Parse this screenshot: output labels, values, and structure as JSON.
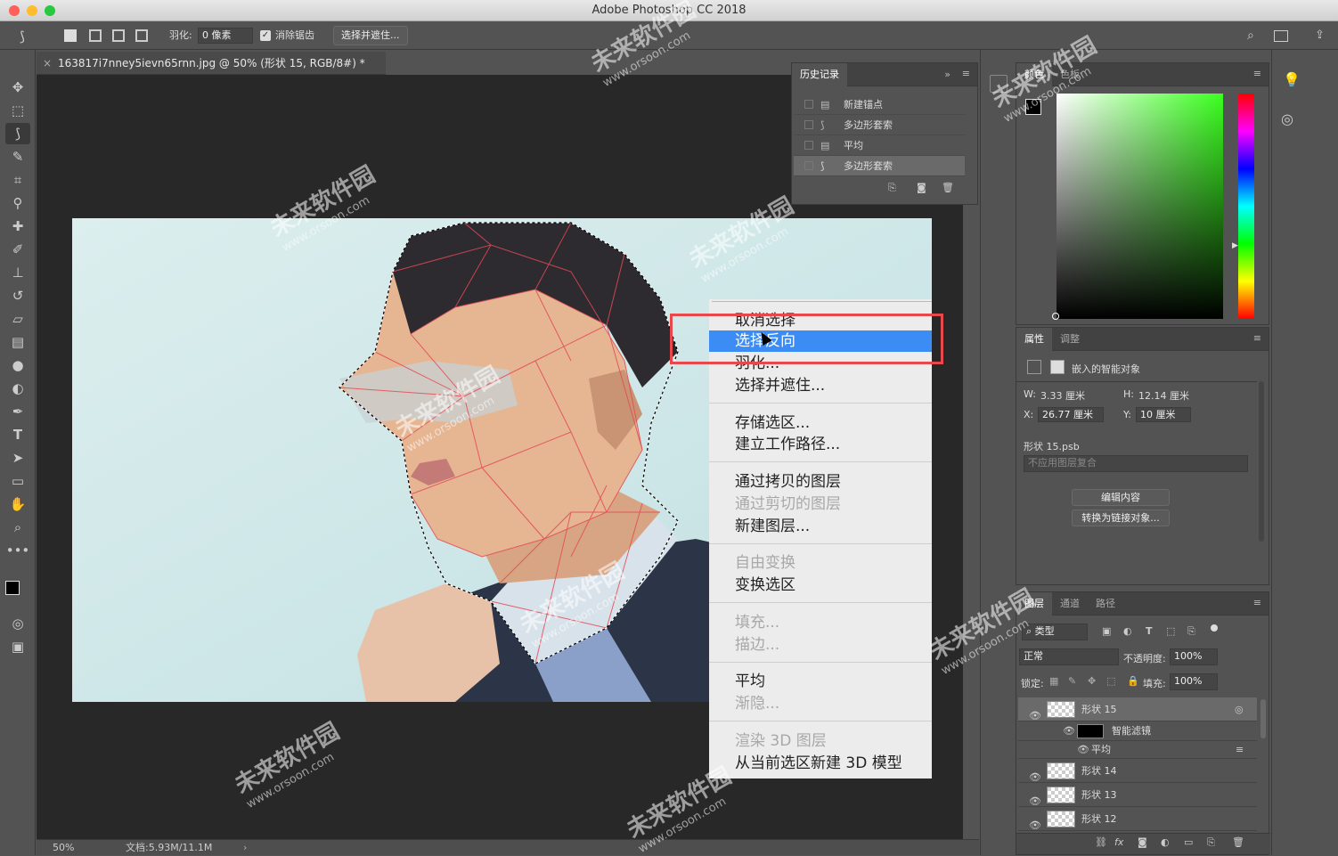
{
  "window": {
    "title": "Adobe Photoshop CC 2018"
  },
  "options_bar": {
    "feather_label": "羽化:",
    "feather_value": "0 像素",
    "antialias_label": "消除锯齿",
    "select_mask_button": "选择并遮住..."
  },
  "document": {
    "tab_title": "163817i7nney5ievn65rnn.jpg @ 50% (形状 15, RGB/8#) *",
    "zoom": "50%",
    "doc_size": "文档:5.93M/11.1M"
  },
  "context_menu": {
    "items": [
      {
        "label": "取消选择",
        "disabled": false
      },
      {
        "label": "选择反向",
        "disabled": false,
        "selected": true
      },
      {
        "label": "羽化...",
        "disabled": false
      },
      {
        "label": "选择并遮住...",
        "disabled": false
      },
      {
        "label": "存储选区...",
        "disabled": false
      },
      {
        "label": "建立工作路径...",
        "disabled": false
      },
      {
        "label": "通过拷贝的图层",
        "disabled": false
      },
      {
        "label": "通过剪切的图层",
        "disabled": true
      },
      {
        "label": "新建图层...",
        "disabled": false
      },
      {
        "label": "自由变换",
        "disabled": true
      },
      {
        "label": "变换选区",
        "disabled": false
      },
      {
        "label": "填充...",
        "disabled": true
      },
      {
        "label": "描边...",
        "disabled": true
      },
      {
        "label": "平均",
        "disabled": false
      },
      {
        "label": "渐隐...",
        "disabled": true
      },
      {
        "label": "渲染 3D 图层",
        "disabled": true
      },
      {
        "label": "从当前选区新建 3D 模型",
        "disabled": false
      }
    ]
  },
  "history_panel": {
    "title": "历史记录",
    "items": [
      {
        "label": "新建锚点",
        "icon": "document-icon"
      },
      {
        "label": "多边形套索",
        "icon": "lasso-icon"
      },
      {
        "label": "平均",
        "icon": "document-icon"
      },
      {
        "label": "多边形套索",
        "icon": "lasso-icon"
      }
    ]
  },
  "color_panel": {
    "tabs": [
      "颜色",
      "色板"
    ]
  },
  "properties_panel": {
    "tabs": [
      "属性",
      "调整"
    ],
    "type_label": "嵌入的智能对象",
    "w_label": "W:",
    "w_value": "3.33 厘米",
    "h_label": "H:",
    "h_value": "12.14 厘米",
    "x_label": "X:",
    "x_value": "26.77 厘米",
    "y_label": "Y:",
    "y_value": "10 厘米",
    "file_name": "形状 15.psb",
    "comp_select": "不应用图层复合",
    "edit_button": "编辑内容",
    "convert_button": "转换为链接对象..."
  },
  "layers_panel": {
    "tabs": [
      "图层",
      "通道",
      "路径"
    ],
    "filter_label": "类型",
    "blend_mode": "正常",
    "opacity_label": "不透明度:",
    "opacity_value": "100%",
    "lock_label": "锁定:",
    "fill_label": "填充:",
    "fill_value": "100%",
    "layers": [
      {
        "name": "形状 15"
      },
      {
        "name": "智能滤镜"
      },
      {
        "name": "平均"
      },
      {
        "name": "形状 14"
      },
      {
        "name": "形状 13"
      },
      {
        "name": "形状 12"
      }
    ]
  },
  "watermark": {
    "text": "未来软件园",
    "url": "www.orsoon.com"
  },
  "colors": {
    "accent": "#3b8cf5",
    "highlight_box": "#e8474b",
    "menu_bg": "#ececec"
  }
}
